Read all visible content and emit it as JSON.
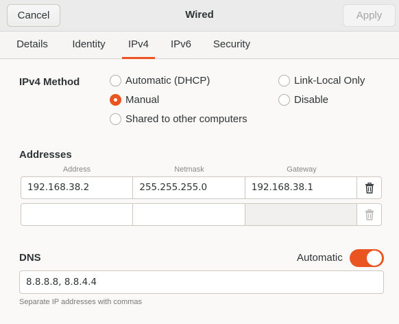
{
  "header": {
    "title": "Wired",
    "cancel_label": "Cancel",
    "apply_label": "Apply"
  },
  "tabs": [
    {
      "label": "Details"
    },
    {
      "label": "Identity"
    },
    {
      "label": "IPv4",
      "active": true
    },
    {
      "label": "IPv6"
    },
    {
      "label": "Security"
    }
  ],
  "ipv4_method": {
    "label": "IPv4 Method",
    "options": [
      {
        "label": "Automatic (DHCP)",
        "checked": false
      },
      {
        "label": "Link-Local Only",
        "checked": false
      },
      {
        "label": "Manual",
        "checked": true
      },
      {
        "label": "Disable",
        "checked": false
      },
      {
        "label": "Shared to other computers",
        "checked": false
      }
    ]
  },
  "addresses": {
    "label": "Addresses",
    "columns": [
      "Address",
      "Netmask",
      "Gateway"
    ],
    "rows": [
      [
        "192.168.38.2",
        "255.255.255.0",
        "192.168.38.1"
      ],
      [
        "",
        "",
        ""
      ]
    ]
  },
  "dns": {
    "label": "DNS",
    "automatic_label": "Automatic",
    "automatic_on": true,
    "value": "8.8.8.8, 8.8.4.4",
    "hint": "Separate IP addresses with commas"
  },
  "colors": {
    "accent": "#e95420"
  }
}
